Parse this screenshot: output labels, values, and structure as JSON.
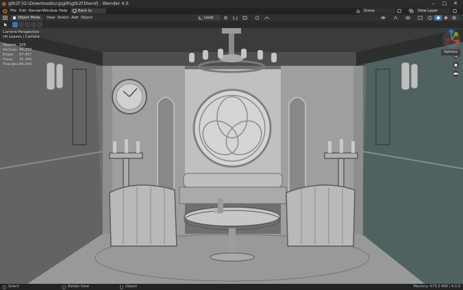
{
  "window": {
    "title": "gth2f [G:\\Downloads\\cg\\gth\\gth2f.blend] - Blender 4.0",
    "controls": [
      "–",
      "□",
      "✕"
    ]
  },
  "menubar": {
    "items": [
      "File",
      "Edit",
      "Render",
      "Window",
      "Help"
    ],
    "back_button": "Back to Previous",
    "scene_label": "Scene",
    "view_layer_label": "View Layer"
  },
  "header": {
    "mode": "Object Mode",
    "menus": [
      "View",
      "Select",
      "Add",
      "Object"
    ],
    "transform_orientation": "Local"
  },
  "viewport": {
    "camera_title": "Camera Perspective",
    "collection_line": "(4) Leaves | Camera",
    "stats": [
      {
        "label": "Objects",
        "value": "105"
      },
      {
        "label": "Vertices",
        "value": "45,320"
      },
      {
        "label": "Edges",
        "value": "87,457"
      },
      {
        "label": "Faces",
        "value": "42,389"
      },
      {
        "label": "Triangles",
        "value": "89,546"
      }
    ],
    "options_label": "Options",
    "gizmo_axes": {
      "x": "X",
      "y": "Y",
      "z": "Z"
    }
  },
  "statusbar": {
    "select": "Select",
    "rotate": "Rotate View",
    "object": "Object",
    "memory": "Memory: 673.0 MiB | 4.0.0"
  },
  "colors": {
    "accent": "#4772b3",
    "axis_x": "#e0443e",
    "axis_y": "#79b41c",
    "axis_z": "#3a7fe0"
  }
}
